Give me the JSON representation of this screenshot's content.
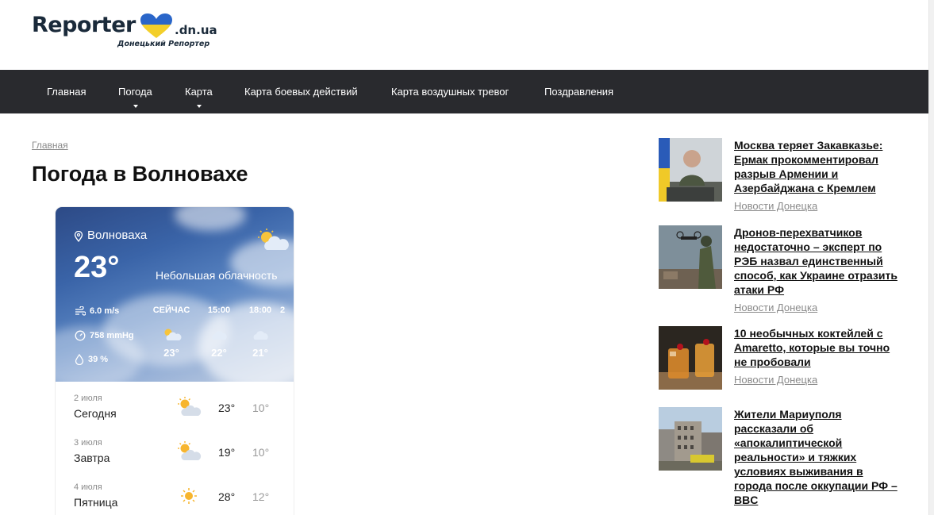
{
  "header": {
    "logo_word": "Reporter",
    "logo_domain": ".dn.ua",
    "logo_subtitle": "Донецький Репортер"
  },
  "nav": {
    "items": [
      {
        "label": "Главная"
      },
      {
        "label": "Погода",
        "has_dropdown": true
      },
      {
        "label": "Карта",
        "has_dropdown": true
      },
      {
        "label": "Карта боевых действий"
      },
      {
        "label": "Карта воздушных тревог"
      },
      {
        "label": "Поздравления"
      }
    ]
  },
  "breadcrumb": "Главная",
  "page_title": "Погода в Волновахе",
  "weather": {
    "location": "Волноваха",
    "temperature": "23°",
    "description": "Небольшая облачность",
    "wind": "6.0 m/s",
    "pressure": "758 mmHg",
    "humidity": "39 %",
    "hourly": [
      {
        "label": "СЕЙЧАС",
        "icon": "partly-cloudy-icon",
        "temp": "23°"
      },
      {
        "label": "15:00",
        "icon": "cloud-icon",
        "temp": "22°"
      },
      {
        "label": "18:00",
        "icon": "cloud-icon",
        "temp": "21°"
      },
      {
        "label": "2",
        "icon": "cloud-icon",
        "temp": ""
      }
    ],
    "daily": [
      {
        "date": "2 июля",
        "day": "Сегодня",
        "icon": "partly-cloudy-icon",
        "max": "23°",
        "min": "10°"
      },
      {
        "date": "3 июля",
        "day": "Завтра",
        "icon": "partly-cloudy-icon",
        "max": "19°",
        "min": "10°"
      },
      {
        "date": "4 июля",
        "day": "Пятница",
        "icon": "sun-icon",
        "max": "28°",
        "min": "12°"
      }
    ]
  },
  "sidebar": {
    "news": [
      {
        "title": "Москва теряет Закавказье: Ермак прокомментировал разрыв Армении и Азербайджана с Кремлем",
        "category": "Новости Донецка"
      },
      {
        "title": "Дронов-перехватчиков недостаточно – эксперт по РЭБ назвал единственный способ, как Украине отразить атаки РФ",
        "category": "Новости Донецка"
      },
      {
        "title": "10 необычных коктейлей с Amaretto, которые вы точно не пробовали",
        "category": "Новости Донецка"
      },
      {
        "title": "Жители Мариуполя рассказали об «апокалиптической реальности» и тяжких условиях выживания в города после оккупации РФ – BBC",
        "category": ""
      }
    ]
  },
  "colors": {
    "nav_bg": "#292a2e",
    "sky_top": "#2d4a86",
    "flag_blue": "#2a66c9",
    "flag_yellow": "#f3cf2a"
  }
}
